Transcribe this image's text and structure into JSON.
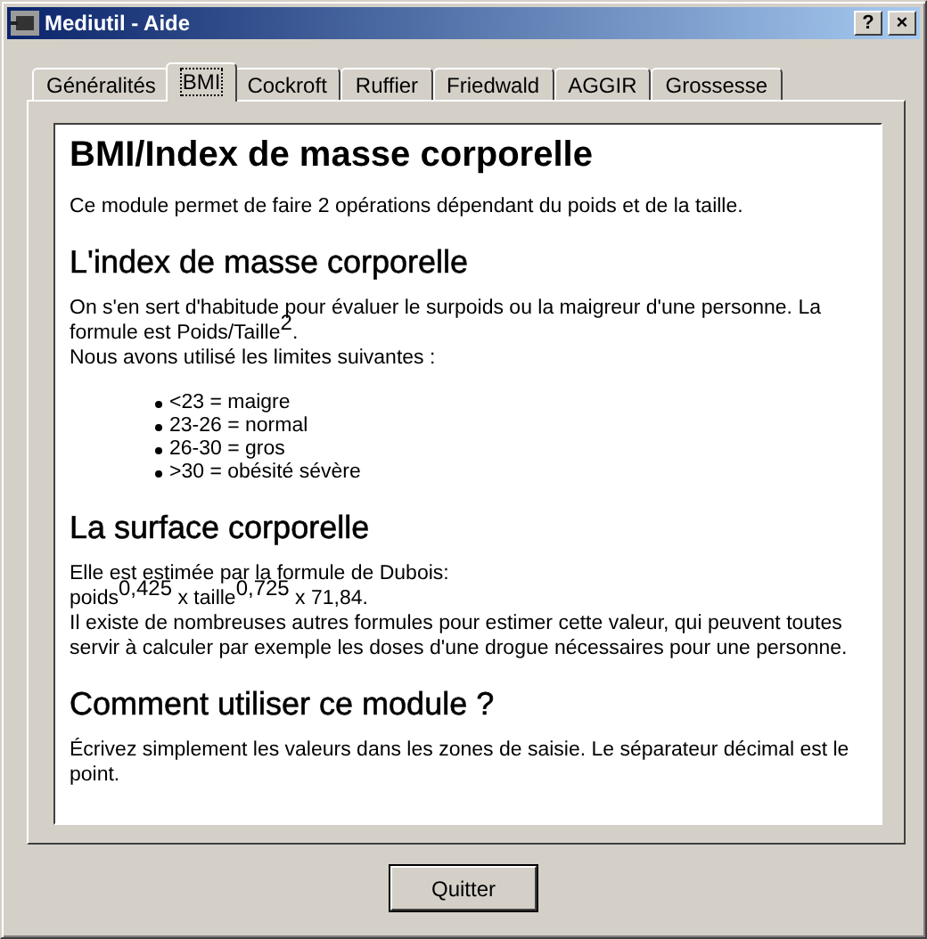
{
  "window": {
    "title": "Mediutil - Aide",
    "help_button": "?",
    "close_button": "×"
  },
  "tabs": [
    {
      "label": "Généralités",
      "selected": false
    },
    {
      "label": "BMI",
      "selected": true
    },
    {
      "label": "Cockroft",
      "selected": false
    },
    {
      "label": "Ruffier",
      "selected": false
    },
    {
      "label": "Friedwald",
      "selected": false
    },
    {
      "label": "AGGIR",
      "selected": false
    },
    {
      "label": "Grossesse",
      "selected": false
    }
  ],
  "content": [
    {
      "kind": "h1",
      "text": "BMI/Index de masse corporelle"
    },
    {
      "kind": "p",
      "text": "Ce module permet de faire 2 opérations dépendant du poids et de la taille."
    },
    {
      "kind": "h2",
      "text": "L'index de masse corporelle"
    },
    {
      "kind": "p",
      "text": "On s'en sert d'habitude pour évaluer le surpoids ou la maigreur d'une personne. La formule est Poids/Taille$^{2}$.\nNous avons utilisé les limites suivantes :"
    },
    {
      "kind": "list",
      "items": [
        "<23 = maigre",
        "23-26 = normal",
        "26-30 = gros",
        ">30 = obésité sévère"
      ]
    },
    {
      "kind": "h2",
      "text": "La surface corporelle"
    },
    {
      "kind": "p",
      "text": "Elle est estimée par la formule de Dubois:\npoids$^{0,425}$ x taille$^{0,725}$ x 71,84.\nIl existe de nombreuses autres formules pour estimer cette valeur, qui peuvent toutes servir à calculer par exemple les doses d'une drogue nécessaires pour une personne."
    },
    {
      "kind": "h2",
      "text": "Comment utiliser ce module ?"
    },
    {
      "kind": "p",
      "text": "Écrivez simplement les valeurs dans les zones de saisie. Le séparateur décimal est le point."
    }
  ],
  "buttons": [
    "Quitter"
  ]
}
